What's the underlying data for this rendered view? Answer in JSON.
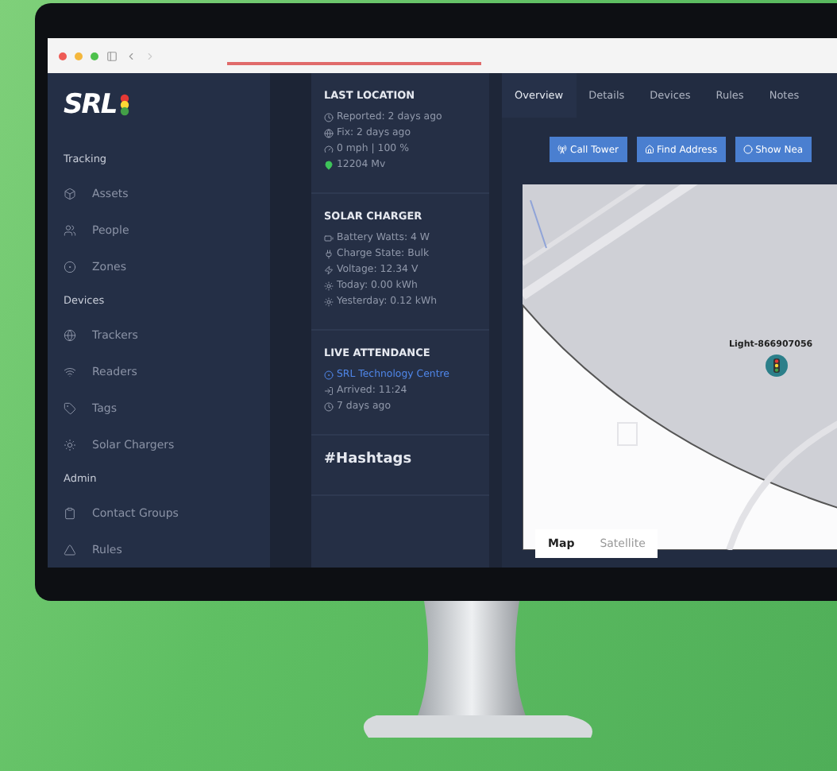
{
  "logo": "SRL",
  "sidebar": [
    {
      "title": "Tracking",
      "items": [
        {
          "label": "Assets"
        },
        {
          "label": "People"
        },
        {
          "label": "Zones"
        }
      ]
    },
    {
      "title": "Devices",
      "items": [
        {
          "label": "Trackers"
        },
        {
          "label": "Readers"
        },
        {
          "label": "Tags"
        },
        {
          "label": "Solar Chargers"
        }
      ]
    },
    {
      "title": "Admin",
      "items": [
        {
          "label": "Contact Groups"
        },
        {
          "label": "Rules"
        }
      ]
    }
  ],
  "cards": [
    {
      "title": "LAST LOCATION",
      "lines": [
        {
          "kind": "text",
          "text": "Reported: 2 days ago"
        },
        {
          "kind": "text",
          "text": "Fix: 2 days ago"
        },
        {
          "kind": "text",
          "text": "0 mph   |   100 %"
        },
        {
          "kind": "text",
          "text": "12204 Mv",
          "color": "#3ec45a"
        }
      ]
    },
    {
      "title": "SOLAR CHARGER",
      "lines": [
        {
          "kind": "text",
          "text": "Battery Watts: 4 W"
        },
        {
          "kind": "text",
          "text": "Charge State: Bulk"
        },
        {
          "kind": "text",
          "text": "Voltage: 12.34 V"
        },
        {
          "kind": "text",
          "text": "Today: 0.00 kWh"
        },
        {
          "kind": "text",
          "text": "Yesterday: 0.12 kWh"
        }
      ]
    },
    {
      "title": "LIVE ATTENDANCE",
      "lines": [
        {
          "kind": "link",
          "text": "SRL Technology Centre"
        },
        {
          "kind": "text",
          "text": "Arrived: 11:24"
        },
        {
          "kind": "text",
          "text": "7 days ago"
        }
      ]
    },
    {
      "title": "#Hashtags"
    }
  ],
  "tabs": [
    {
      "label": "Overview",
      "selected": true
    },
    {
      "label": "Details",
      "selected": false
    },
    {
      "label": "Devices",
      "selected": false
    },
    {
      "label": "Rules",
      "selected": false
    },
    {
      "label": "Notes",
      "selected": false
    }
  ],
  "actions": [
    "Call Tower",
    "Find Address",
    "Show Nea"
  ],
  "map": {
    "marker_label": "Light-866907056",
    "map_types": [
      {
        "label": "Map",
        "selected": true
      },
      {
        "label": "Satellite",
        "selected": false
      }
    ]
  }
}
